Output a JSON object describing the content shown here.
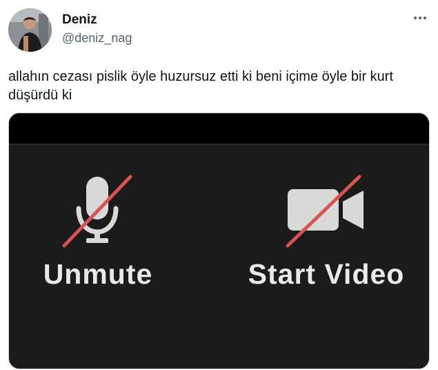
{
  "author": {
    "display_name": "Deniz",
    "handle": "@deniz_nag"
  },
  "tweet": {
    "text": "allahın cezası pislik öyle huzursuz etti ki beni içime öyle bir kurt düşürdü ki"
  },
  "media": {
    "controls": [
      {
        "label": "Unmute",
        "icon": "microphone-muted-icon"
      },
      {
        "label": "Start Video",
        "icon": "video-camera-off-icon"
      }
    ],
    "colors": {
      "background": "#1b1b1b",
      "topbar": "#000000",
      "icon": "#d9d9d9",
      "slash": "#d9534f",
      "label": "#e9e9e9"
    }
  },
  "icons": {
    "more": "more-horizontal-icon"
  }
}
